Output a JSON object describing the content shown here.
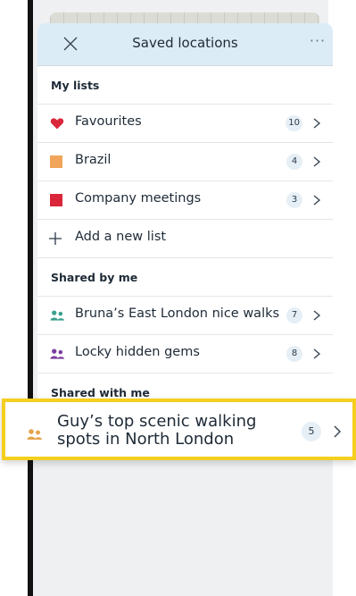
{
  "header": {
    "title": "Saved locations",
    "close_icon": "close-icon",
    "more_label": "···"
  },
  "my_lists": {
    "heading": "My lists",
    "items": [
      {
        "label": "Favourites",
        "count": "10",
        "icon": "heart-icon",
        "color": "#d9263a"
      },
      {
        "label": "Brazil",
        "count": "4",
        "icon": "square-icon",
        "color": "#f0a55a"
      },
      {
        "label": "Company meetings",
        "count": "3",
        "icon": "square-icon",
        "color": "#d9263a"
      }
    ],
    "add_label": "Add a new list"
  },
  "shared_by_me": {
    "heading": "Shared by me",
    "items": [
      {
        "label": "Bruna’s East London nice walks",
        "count": "7",
        "icon": "people-icon",
        "color": "#3aa08e"
      },
      {
        "label": "Locky hidden gems",
        "count": "8",
        "icon": "people-icon",
        "color": "#7a3d9e"
      }
    ]
  },
  "shared_with_me": {
    "heading": "Shared with me",
    "items": [
      {
        "label": "Guy’s top scenic walking spots in North London",
        "count": "5",
        "icon": "people-icon",
        "color": "#e5a24a"
      }
    ]
  },
  "colors": {
    "header_bg": "#dcecf6",
    "highlight_border": "#f4cf1f",
    "badge_bg": "#e6eff6"
  }
}
